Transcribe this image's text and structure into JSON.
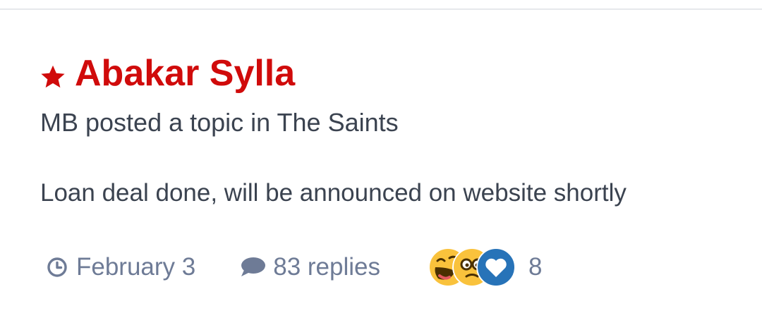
{
  "topic": {
    "title": "Abakar Sylla",
    "meta": "MB posted a topic in The Saints",
    "snippet": "Loan deal done, will be announced on website shortly",
    "featured_icon": "star-icon"
  },
  "stats": {
    "date_icon": "clock-icon",
    "date": "February 3",
    "replies_icon": "speech-bubble-icon",
    "replies": "83 replies",
    "reactions": [
      "haha-reaction-icon",
      "confused-reaction-icon",
      "heart-reaction-icon"
    ],
    "reaction_count": "8"
  },
  "colors": {
    "title": "#d00b0b",
    "text": "#3b4350",
    "muted": "#6e7b96",
    "heart_bg": "#2773b8"
  }
}
